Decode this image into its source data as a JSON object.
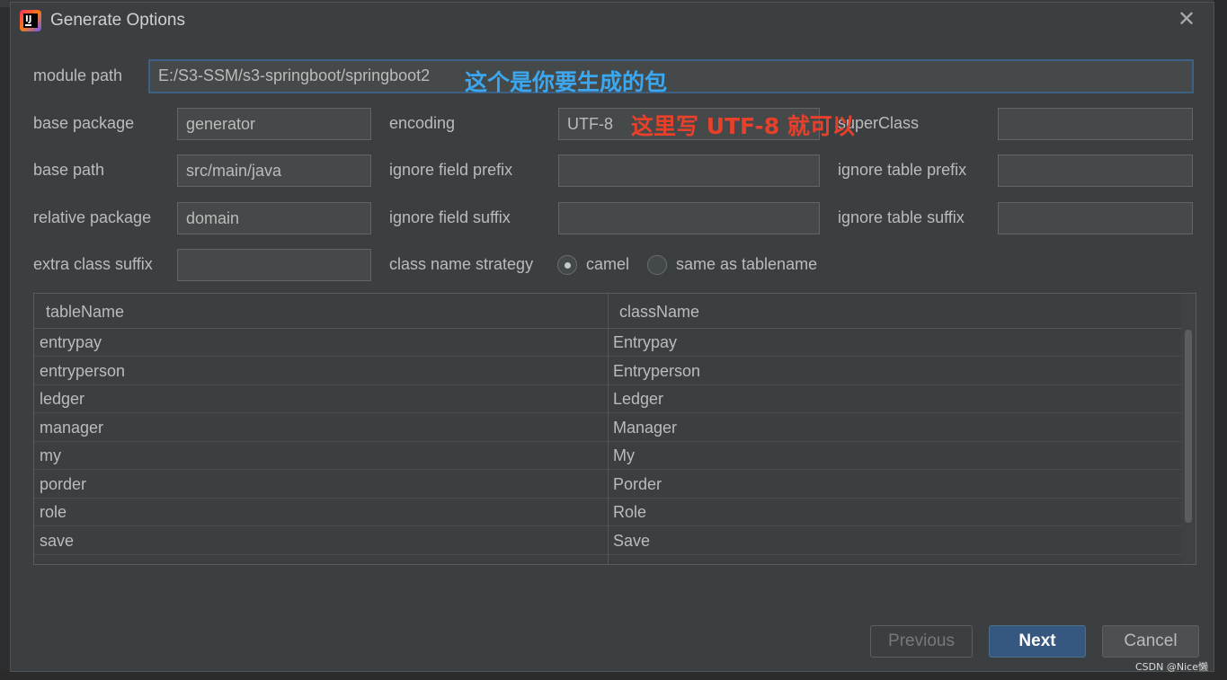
{
  "dialog": {
    "title": "Generate Options",
    "close_symbol": "✕"
  },
  "form": {
    "module_path": {
      "label": "module path",
      "value": "E:/S3-SSM/s3-springboot/springboot2"
    },
    "base_package": {
      "label": "base package",
      "value": "generator"
    },
    "base_path": {
      "label": "base path",
      "value": "src/main/java"
    },
    "relative_package": {
      "label": "relative package",
      "value": "domain"
    },
    "extra_class_suffix": {
      "label": "extra class suffix",
      "value": ""
    },
    "encoding": {
      "label": "encoding",
      "value": "UTF-8"
    },
    "ignore_field_prefix": {
      "label": "ignore field prefix",
      "value": ""
    },
    "ignore_field_suffix": {
      "label": "ignore field suffix",
      "value": ""
    },
    "super_class": {
      "label": "superClass",
      "value": ""
    },
    "ignore_table_prefix": {
      "label": "ignore table prefix",
      "value": ""
    },
    "ignore_table_suffix": {
      "label": "ignore table suffix",
      "value": ""
    },
    "class_name_strategy": {
      "label": "class name strategy",
      "options": [
        "camel",
        "same as tablename"
      ],
      "selected": "camel"
    }
  },
  "annotations": {
    "module_path_note": "这个是你要生成的包",
    "encoding_note": "这里写 UTF-8 就可以"
  },
  "table": {
    "columns": [
      "tableName",
      "className"
    ],
    "rows": [
      [
        "entrypay",
        "Entrypay"
      ],
      [
        "entryperson",
        "Entryperson"
      ],
      [
        "ledger",
        "Ledger"
      ],
      [
        "manager",
        "Manager"
      ],
      [
        "my",
        "My"
      ],
      [
        "porder",
        "Porder"
      ],
      [
        "role",
        "Role"
      ],
      [
        "save",
        "Save"
      ]
    ]
  },
  "buttons": {
    "previous": "Previous",
    "next": "Next",
    "cancel": "Cancel"
  },
  "watermark": "CSDN @Nice懒"
}
